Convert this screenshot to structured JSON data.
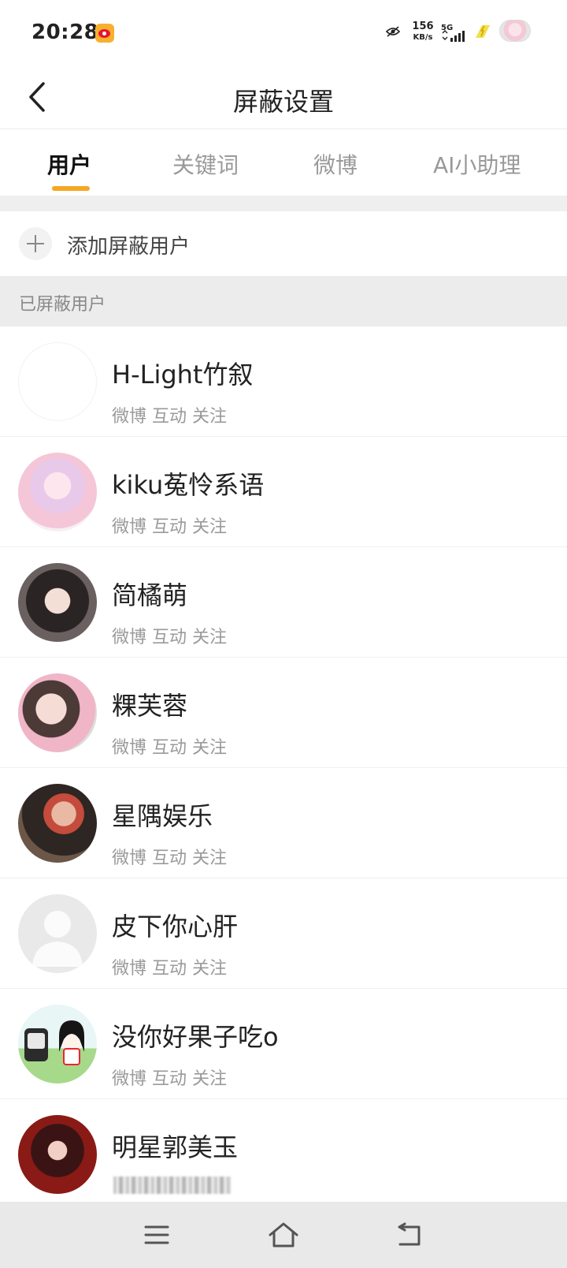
{
  "status_bar": {
    "time": "20:28",
    "net_speed_value": "156",
    "net_speed_unit": "KB/s",
    "network": "5G"
  },
  "header": {
    "title": "屏蔽设置"
  },
  "tabs": [
    {
      "label": "用户",
      "active": true
    },
    {
      "label": "关键词",
      "active": false
    },
    {
      "label": "微博",
      "active": false
    },
    {
      "label": "AI小助理",
      "active": false
    }
  ],
  "add_blocked_user_label": "添加屏蔽用户",
  "section_title": "已屏蔽用户",
  "users": [
    {
      "name": "H-Light竹叙",
      "sub": "微博 互动 关注"
    },
    {
      "name": "kiku菟怜系语",
      "sub": "微博 互动 关注"
    },
    {
      "name": "简橘萌",
      "sub": "微博 互动 关注"
    },
    {
      "name": "粿芙蓉",
      "sub": "微博 互动 关注"
    },
    {
      "name": "星隅娱乐",
      "sub": "微博 互动 关注"
    },
    {
      "name": "皮下你心肝",
      "sub": "微博 互动 关注"
    },
    {
      "name": "没你好果子吃o",
      "sub": "微博 互动 关注"
    },
    {
      "name": "明星郭美玉",
      "sub": ""
    }
  ],
  "colors": {
    "accent": "#f5a623",
    "section_bg": "#ececec",
    "muted_text": "#9a9a9a"
  }
}
